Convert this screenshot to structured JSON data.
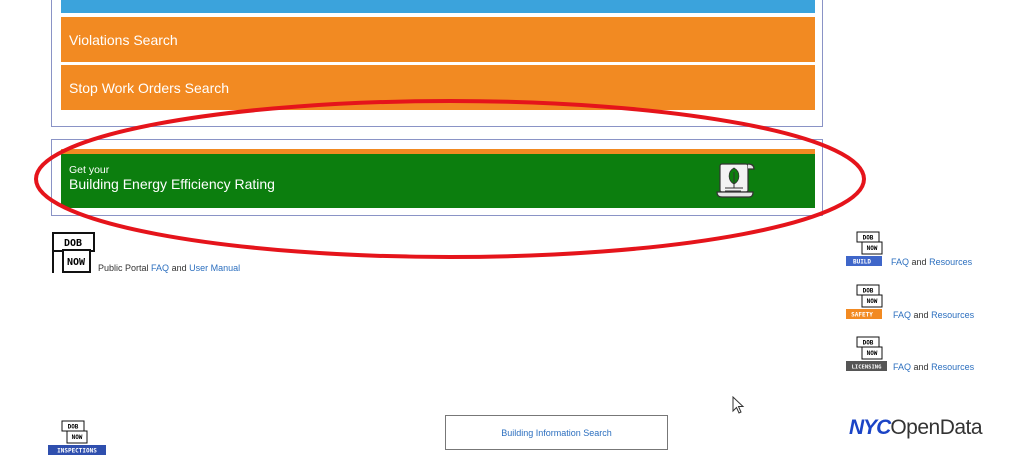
{
  "menu": {
    "violations_label": "Violations Search",
    "stop_work_label": "Stop Work Orders Search"
  },
  "energy_banner": {
    "line1": "Get your",
    "line2": "Building Energy Efficiency Rating"
  },
  "dob_logo": {
    "top": "DOB",
    "bottom": "NOW"
  },
  "public_portal": {
    "prefix": "Public Portal",
    "faq": "FAQ",
    "and": "and",
    "manual": "User Manual"
  },
  "resources": [
    {
      "badge": "BUILD",
      "badge_color": "#3f66c9",
      "faq": "FAQ",
      "and": "and",
      "link": "Resources"
    },
    {
      "badge": "SAFETY",
      "badge_color": "#f28a22",
      "faq": "FAQ",
      "and": "and",
      "link": "Resources"
    },
    {
      "badge": "LICENSING",
      "badge_color": "#555555",
      "faq": "FAQ",
      "and": "and",
      "link": "Resources"
    }
  ],
  "inspections_badge": "INSPECTIONS",
  "building_info_button": "Building Information Search",
  "nyc_open_data": {
    "nyc": "NYC",
    "open": "OpenData"
  },
  "colors": {
    "orange": "#f28a22",
    "green": "#0c7e0e",
    "blue": "#3ba3dc",
    "link": "#2c6fbf",
    "annotation_red": "#e5141b"
  }
}
